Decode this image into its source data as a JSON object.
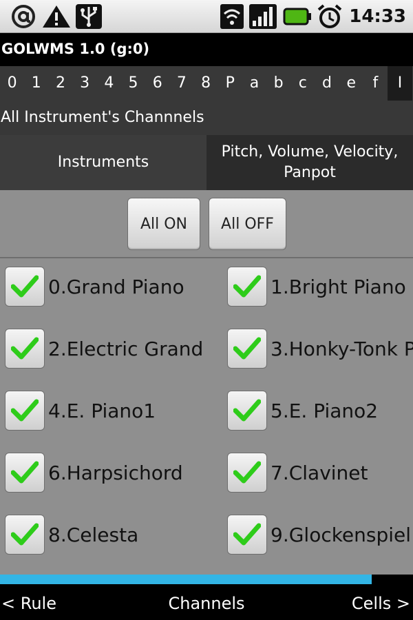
{
  "status_bar": {
    "time": "14:33",
    "left_icons": [
      "at-sign-icon",
      "warning-icon",
      "usb-icon"
    ],
    "right_icons": [
      "wifi-icon",
      "signal-icon",
      "battery-icon",
      "alarm-clock-icon"
    ]
  },
  "app": {
    "title": "GOLWMS 1.0 (g:0)"
  },
  "channels": [
    "0",
    "1",
    "2",
    "3",
    "4",
    "5",
    "6",
    "7",
    "8",
    "P",
    "a",
    "b",
    "c",
    "d",
    "e",
    "f",
    "I"
  ],
  "section_title": "All Instrument's Channnels",
  "subtabs": {
    "instruments": "Instruments",
    "pitch_line1": "Pitch, Volume, Velocity,",
    "pitch_line2": "Panpot"
  },
  "buttons": {
    "all_on": "All ON",
    "all_off": "All OFF"
  },
  "instruments": [
    {
      "label": "0.Grand Piano",
      "checked": true
    },
    {
      "label": "1.Bright Piano",
      "checked": true
    },
    {
      "label": "2.Electric Grand",
      "checked": true
    },
    {
      "label": "3.Honky-Tonk P",
      "checked": true
    },
    {
      "label": "4.E. Piano1",
      "checked": true
    },
    {
      "label": "5.E. Piano2",
      "checked": true
    },
    {
      "label": "6.Harpsichord",
      "checked": true
    },
    {
      "label": "7.Clavinet",
      "checked": true
    },
    {
      "label": "8.Celesta",
      "checked": true
    },
    {
      "label": "9.Glockenspiel",
      "checked": true
    }
  ],
  "progress": {
    "fraction": 0.9
  },
  "bottom_bar": {
    "left": "< Rule",
    "center": "Channels",
    "right": "Cells >"
  },
  "colors": {
    "accent": "#33b5e5",
    "check": "#2ecc1a"
  }
}
